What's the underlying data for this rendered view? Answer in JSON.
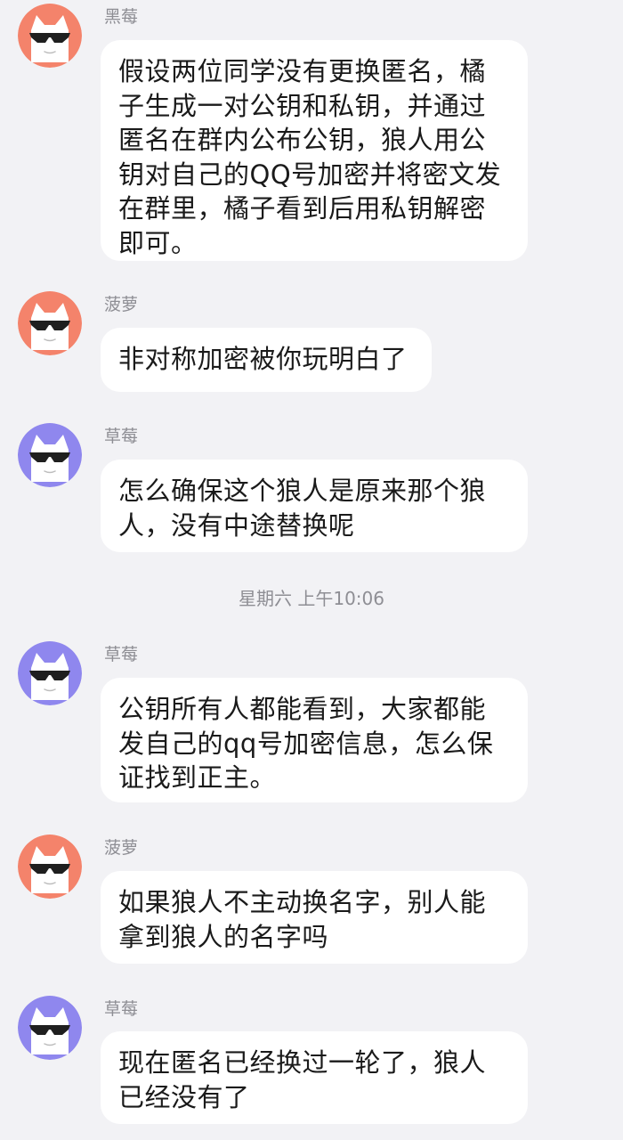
{
  "chat": {
    "messages": [
      {
        "sender": "黑莓",
        "avatar_color": "#f4836b",
        "avatar_icon": "white-cat-with-sunglasses",
        "text": "假设两位同学没有更换匿名，橘子生成一对公钥和私钥，并通过匿名在群内公布公钥，狼人用公钥对自己的QQ号加密并将密文发在群里，橘子看到后用私钥解密即可。"
      },
      {
        "sender": "菠萝",
        "avatar_color": "#f4836b",
        "avatar_icon": "white-cat-with-sunglasses",
        "text": "非对称加密被你玩明白了"
      },
      {
        "sender": "草莓",
        "avatar_color": "#8f87ee",
        "avatar_icon": "white-cat-with-sunglasses",
        "text": "怎么确保这个狼人是原来那个狼人，没有中途替换呢"
      },
      {
        "sender": "草莓",
        "avatar_color": "#8f87ee",
        "avatar_icon": "white-cat-with-sunglasses",
        "text": "公钥所有人都能看到，大家都能发自己的qq号加密信息，怎么保证找到正主。"
      },
      {
        "sender": "菠萝",
        "avatar_color": "#f4836b",
        "avatar_icon": "white-cat-with-sunglasses",
        "text": "如果狼人不主动换名字，别人能拿到狼人的名字吗"
      },
      {
        "sender": "草莓",
        "avatar_color": "#8f87ee",
        "avatar_icon": "white-cat-with-sunglasses",
        "text": "现在匿名已经换过一轮了，狼人已经没有了"
      }
    ],
    "time_divider": "星期六 上午10:06"
  }
}
